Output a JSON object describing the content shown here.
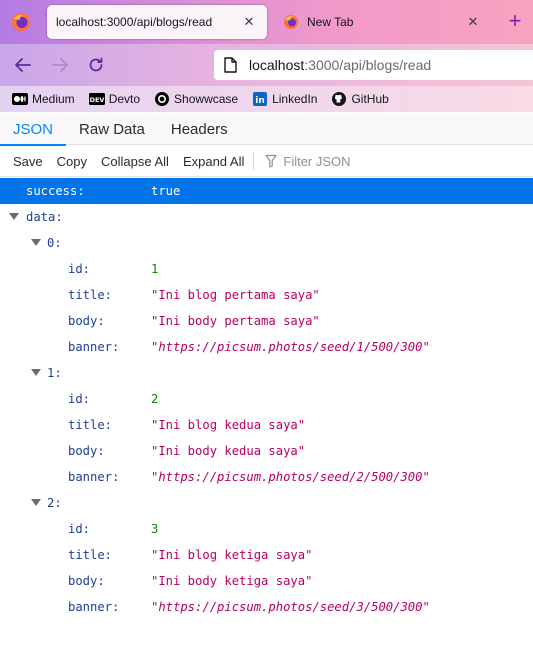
{
  "browser": {
    "tabs": [
      {
        "title": "localhost:3000/api/blogs/read",
        "active": true
      },
      {
        "title": "New Tab",
        "active": false
      }
    ],
    "url": {
      "host": "localhost",
      "path": ":3000/api/blogs/read"
    },
    "bookmarks": [
      {
        "label": "Medium",
        "icon": "medium-icon"
      },
      {
        "label": "Devto",
        "icon": "dev-icon"
      },
      {
        "label": "Showwcase",
        "icon": "showwcase-icon"
      },
      {
        "label": "LinkedIn",
        "icon": "linkedin-icon"
      },
      {
        "label": "GitHub",
        "icon": "github-icon"
      }
    ],
    "colors": {
      "accent": "#0a84ff",
      "selected_row": "#0074e8",
      "new_tab_plus": "#7a22b3"
    }
  },
  "json_viewer": {
    "tabs": [
      "JSON",
      "Raw Data",
      "Headers"
    ],
    "selected_tab": "JSON",
    "toolbar": {
      "save": "Save",
      "copy": "Copy",
      "collapse_all": "Collapse All",
      "expand_all": "Expand All",
      "filter_placeholder": "Filter JSON"
    },
    "rows": [
      {
        "key": "success:",
        "value": "true",
        "type": "bool"
      },
      {
        "key": "data:"
      },
      {
        "key": "0:"
      },
      {
        "key": "id:",
        "value": "1",
        "type": "num"
      },
      {
        "key": "title:",
        "value": "\"Ini blog pertama saya\"",
        "type": "str"
      },
      {
        "key": "body:",
        "value": "\"Ini body pertama saya\"",
        "type": "str"
      },
      {
        "key": "banner:",
        "value": "\"https://picsum.photos/seed/1/500/300\"",
        "type": "url"
      },
      {
        "key": "1:"
      },
      {
        "key": "id:",
        "value": "2",
        "type": "num"
      },
      {
        "key": "title:",
        "value": "\"Ini blog kedua saya\"",
        "type": "str"
      },
      {
        "key": "body:",
        "value": "\"Ini body kedua saya\"",
        "type": "str"
      },
      {
        "key": "banner:",
        "value": "\"https://picsum.photos/seed/2/500/300\"",
        "type": "url"
      },
      {
        "key": "2:"
      },
      {
        "key": "id:",
        "value": "3",
        "type": "num"
      },
      {
        "key": "title:",
        "value": "\"Ini blog ketiga saya\"",
        "type": "str"
      },
      {
        "key": "body:",
        "value": "\"Ini body ketiga saya\"",
        "type": "str"
      },
      {
        "key": "banner:",
        "value": "\"https://picsum.photos/seed/3/500/300\"",
        "type": "url"
      }
    ]
  }
}
